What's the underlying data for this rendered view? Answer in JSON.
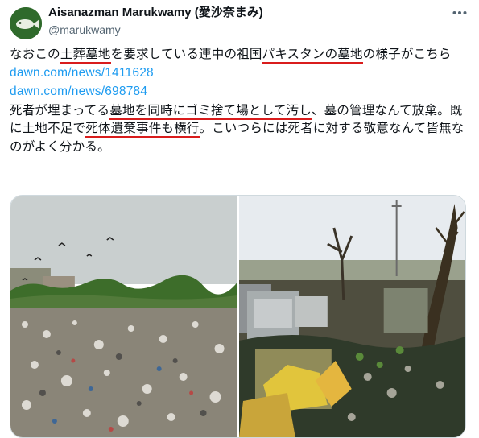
{
  "author": {
    "display_name": "Aisanazman Marukwamy (愛沙奈まみ)",
    "handle": "@marukwamy"
  },
  "tweet": {
    "line1": {
      "pre": "なおこの",
      "u1": "土葬墓地",
      "mid1": "を要求している連中の祖国",
      "u2": "パキスタンの墓地",
      "post": "の様子がこちら"
    },
    "links": [
      "dawn.com/news/1411628",
      "dawn.com/news/698784"
    ],
    "para2": {
      "pre": "死者が埋まってる",
      "u1": "墓地を同時にゴミ捨て場として汚し",
      "mid1": "、墓の管理なんて放棄。既に土地不足で",
      "u2": "死体遺棄事件も横行",
      "post": "。こいつらには死者に対する敬意なんて皆無なのがよく分かる。"
    }
  },
  "media": {
    "images": [
      {
        "alt": "landfill-garbage-photo"
      },
      {
        "alt": "cemetery-with-trash-photo"
      }
    ]
  },
  "colors": {
    "link": "#1d9bf0",
    "underline": "#d91c1c",
    "secondary_text": "#536471"
  },
  "icons": {
    "more": "more-options-icon"
  }
}
